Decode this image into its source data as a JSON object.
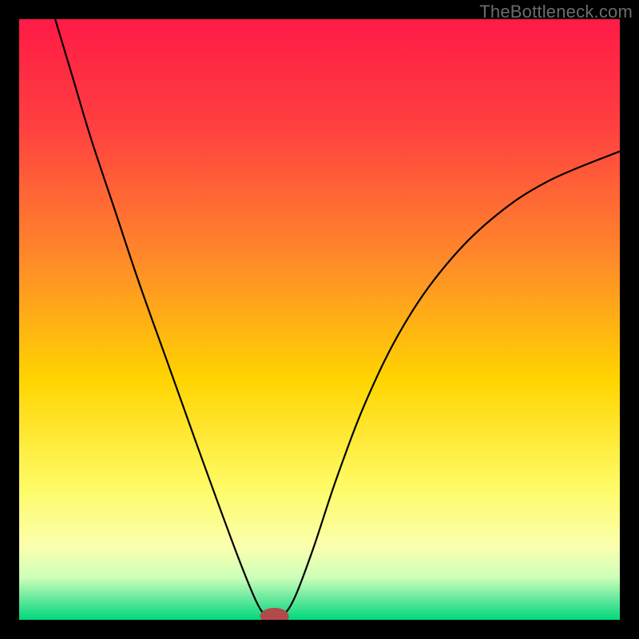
{
  "watermark": "TheBottleneck.com",
  "chart_data": {
    "type": "line",
    "title": "",
    "xlabel": "",
    "ylabel": "",
    "xlim": [
      0,
      100
    ],
    "ylim": [
      0,
      100
    ],
    "grid": false,
    "legend": false,
    "background_gradient": {
      "stops": [
        {
          "pos": 0.0,
          "color": "#ff1a46"
        },
        {
          "pos": 0.18,
          "color": "#ff4040"
        },
        {
          "pos": 0.4,
          "color": "#ff8a2a"
        },
        {
          "pos": 0.6,
          "color": "#ffd400"
        },
        {
          "pos": 0.78,
          "color": "#fffb66"
        },
        {
          "pos": 0.88,
          "color": "#faffb0"
        },
        {
          "pos": 0.93,
          "color": "#ccffb8"
        },
        {
          "pos": 0.965,
          "color": "#66e89e"
        },
        {
          "pos": 1.0,
          "color": "#00d87c"
        }
      ]
    },
    "series": [
      {
        "name": "bottleneck-curve",
        "stroke": "#000000",
        "stroke_width": 2.2,
        "points": [
          {
            "x": 6.0,
            "y": 100.0
          },
          {
            "x": 9.0,
            "y": 90.0
          },
          {
            "x": 12.0,
            "y": 80.0
          },
          {
            "x": 16.0,
            "y": 68.0
          },
          {
            "x": 20.0,
            "y": 56.0
          },
          {
            "x": 25.0,
            "y": 42.0
          },
          {
            "x": 30.0,
            "y": 28.0
          },
          {
            "x": 34.0,
            "y": 17.0
          },
          {
            "x": 37.0,
            "y": 9.0
          },
          {
            "x": 39.5,
            "y": 3.0
          },
          {
            "x": 41.0,
            "y": 0.8
          },
          {
            "x": 42.5,
            "y": 0.4
          },
          {
            "x": 44.0,
            "y": 0.8
          },
          {
            "x": 46.0,
            "y": 4.0
          },
          {
            "x": 49.0,
            "y": 12.0
          },
          {
            "x": 53.0,
            "y": 24.0
          },
          {
            "x": 58.0,
            "y": 37.0
          },
          {
            "x": 64.0,
            "y": 49.0
          },
          {
            "x": 71.0,
            "y": 59.0
          },
          {
            "x": 79.0,
            "y": 67.0
          },
          {
            "x": 88.0,
            "y": 73.0
          },
          {
            "x": 100.0,
            "y": 78.0
          }
        ]
      }
    ],
    "marker": {
      "name": "optimal-point",
      "x": 42.5,
      "y": 0.6,
      "rx": 2.4,
      "ry": 1.4,
      "fill": "#b24a4a"
    }
  }
}
